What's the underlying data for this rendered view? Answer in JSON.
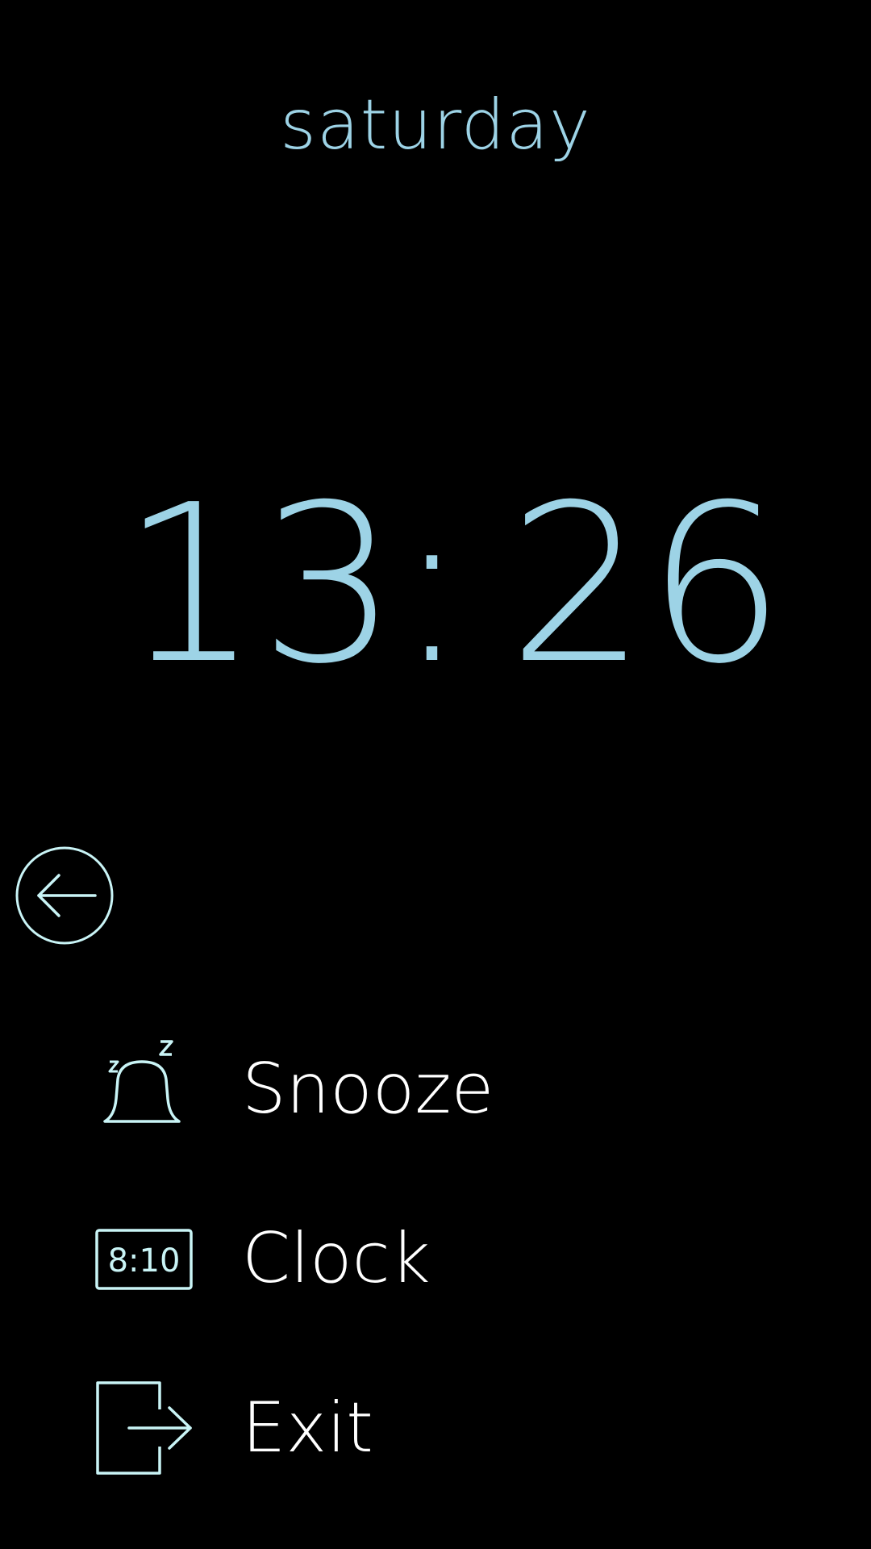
{
  "header": {
    "day": "saturday"
  },
  "clock": {
    "hours": "13",
    "separator": ":",
    "minutes": "26"
  },
  "back": {
    "icon": "back-arrow-circle-icon"
  },
  "menu": {
    "items": [
      {
        "label": "Snooze",
        "icon": "snooze-bell-icon"
      },
      {
        "label": "Clock",
        "icon": "digital-clock-icon",
        "icon_text": "8:10"
      },
      {
        "label": "Exit",
        "icon": "exit-icon"
      }
    ]
  },
  "colors": {
    "accent": "#9dd3e6",
    "icon_stroke": "#c9f4f6",
    "label": "#ffffff",
    "background": "#000000"
  }
}
